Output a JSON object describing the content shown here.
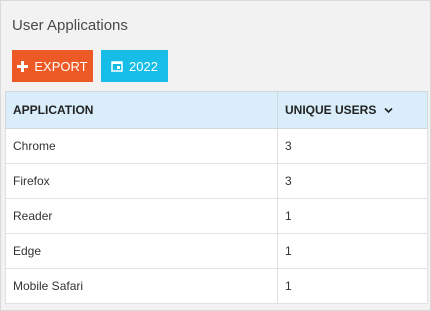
{
  "title": "User Applications",
  "toolbar": {
    "export_label": "EXPORT",
    "year_label": "2022"
  },
  "table": {
    "columns": [
      "APPLICATION",
      "UNIQUE USERS"
    ],
    "sorted_column": "UNIQUE USERS",
    "rows": [
      {
        "application": "Chrome",
        "users": "3"
      },
      {
        "application": "Firefox",
        "users": "3"
      },
      {
        "application": "Reader",
        "users": "1"
      },
      {
        "application": "Edge",
        "users": "1"
      },
      {
        "application": "Mobile Safari",
        "users": "1"
      }
    ]
  },
  "icons": {
    "export": "plus-icon",
    "year": "calendar-icon",
    "sort": "chevron-down-icon"
  },
  "colors": {
    "export_button": "#ee5a26",
    "year_button": "#16bde6",
    "header_bg": "#d9eefa"
  }
}
